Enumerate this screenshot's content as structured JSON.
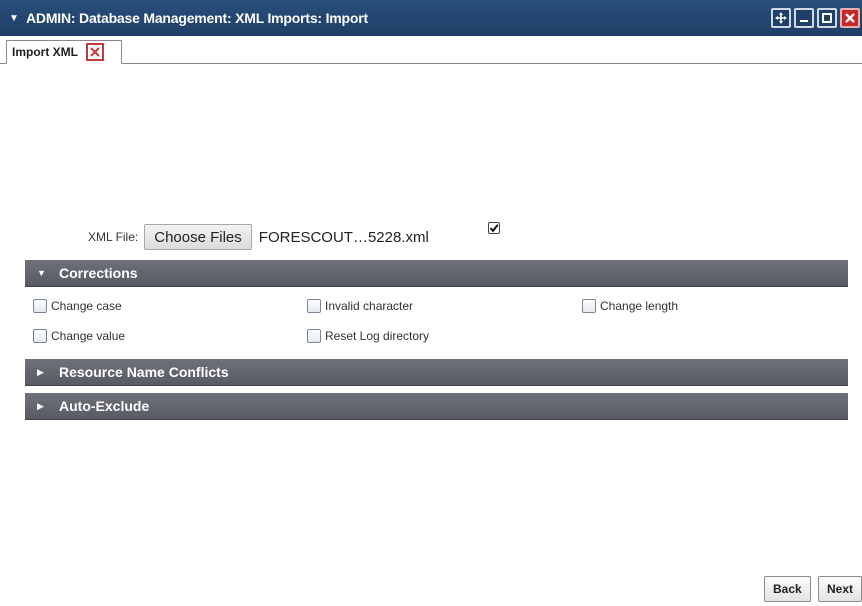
{
  "window": {
    "title": "ADMIN: Database Management: XML Imports: Import"
  },
  "tabs": [
    {
      "label": "Import XML"
    }
  ],
  "file": {
    "label": "XML File:",
    "choose_button": "Choose Files",
    "filename": "FORESCOUT…5228.xml",
    "checked": true
  },
  "sections": {
    "corrections": {
      "label": "Corrections",
      "expanded": true
    },
    "resource_conflicts": {
      "label": "Resource Name Conflicts",
      "expanded": false
    },
    "auto_exclude": {
      "label": "Auto-Exclude",
      "expanded": false
    }
  },
  "corrections_options": [
    {
      "label": "Change case",
      "checked": false
    },
    {
      "label": "Invalid character",
      "checked": false
    },
    {
      "label": "Change length",
      "checked": false
    },
    {
      "label": "Change value",
      "checked": false
    },
    {
      "label": "Reset Log directory",
      "checked": false
    }
  ],
  "footer": {
    "back": "Back",
    "next": "Next"
  },
  "icons": {
    "title_menu": "chevron-down-icon",
    "move": "move-icon",
    "minimize": "minimize-icon",
    "maximize": "maximize-icon",
    "close": "close-icon",
    "tab_close": "close-icon",
    "section_expanded": "caret-down-icon",
    "section_collapsed": "caret-right-icon"
  },
  "colors": {
    "titlebar": "#1e3e66",
    "section_header": "#62646c",
    "close_red": "#c62828"
  }
}
